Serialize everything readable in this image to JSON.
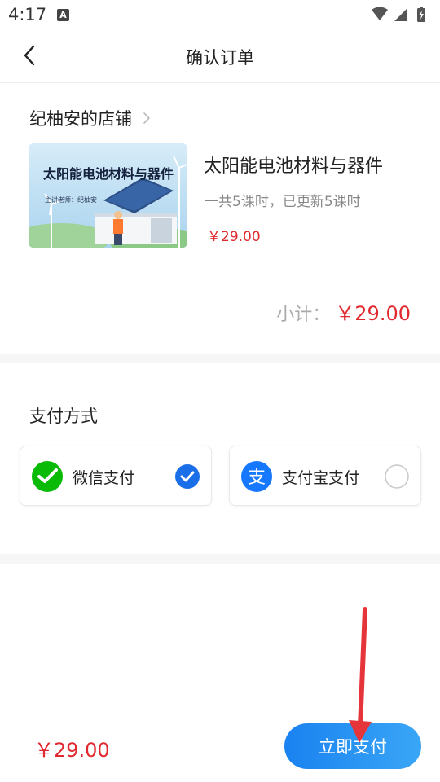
{
  "status_bar": {
    "time": "4:17",
    "notification_icon": "A"
  },
  "header": {
    "title": "确认订单",
    "back_icon": "chevron-left-icon"
  },
  "order": {
    "shop_name": "纪柚安的店铺",
    "course": {
      "thumbnail_title": "太阳能电池材料与器件",
      "thumbnail_teacher": "主讲老师：纪柚安",
      "title": "太阳能电池材料与器件",
      "meta": "一共5课时，已更新5课时",
      "price": "￥29.00"
    },
    "subtotal_label": "小计：",
    "subtotal_value": "￥29.00"
  },
  "payment": {
    "heading": "支付方式",
    "options": [
      {
        "label": "微信支付",
        "icon": "wechat-pay-icon",
        "selected": true
      },
      {
        "label": "支付宝支付",
        "icon": "alipay-icon",
        "selected": false
      }
    ]
  },
  "footer": {
    "total": "￥29.00",
    "pay_button": "立即支付"
  },
  "colors": {
    "accent_blue": "#1a82f0",
    "price_red": "#e0282e",
    "wechat_green": "#09bb07",
    "alipay_blue": "#1677ff",
    "annotation_red": "#e5353a"
  }
}
